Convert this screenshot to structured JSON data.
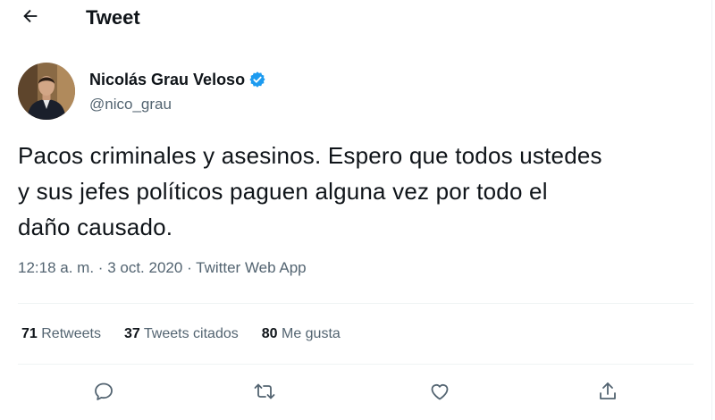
{
  "header": {
    "title": "Tweet"
  },
  "author": {
    "name": "Nicolás Grau Veloso",
    "handle": "@nico_grau"
  },
  "tweet": {
    "text": "Pacos criminales y asesinos. Espero que todos ustedes\ny sus jefes políticos paguen alguna vez por todo el\ndaño causado.",
    "time": "12:18 a. m.",
    "date": "3 oct. 2020",
    "separator": "·",
    "source": "Twitter Web App"
  },
  "stats": {
    "retweets_count": "71",
    "retweets_label": "Retweets",
    "quotes_count": "37",
    "quotes_label": "Tweets citados",
    "likes_count": "80",
    "likes_label": "Me gusta"
  },
  "icons": {
    "back": "arrow-left-icon",
    "verified": "verified-badge-icon",
    "reply": "reply-icon",
    "retweet": "retweet-icon",
    "like": "heart-icon",
    "share": "share-icon"
  },
  "colors": {
    "verified": "#1d9bf0",
    "text": "#0f1419",
    "secondary": "#536471",
    "divider": "#eff3f4"
  }
}
